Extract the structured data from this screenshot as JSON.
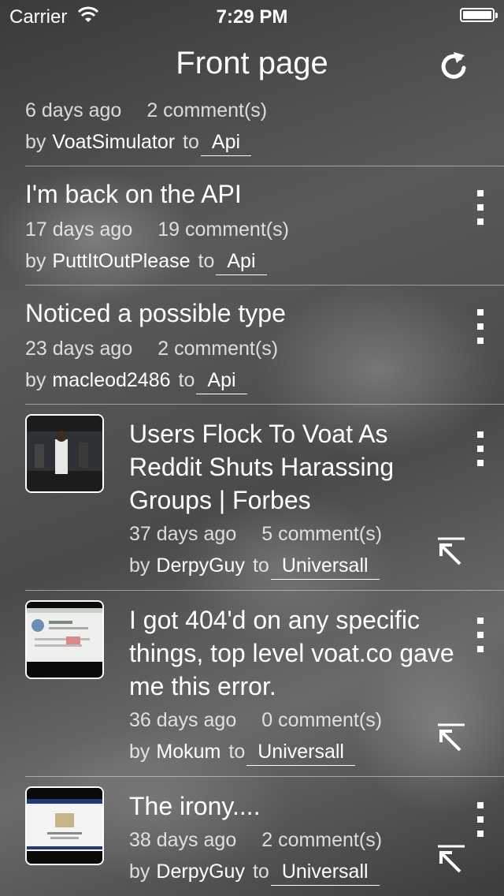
{
  "status_bar": {
    "carrier": "Carrier",
    "time": "7:29 PM"
  },
  "nav": {
    "title": "Front page"
  },
  "posts": [
    {
      "age": "6 days ago",
      "comments": "2 comment(s)",
      "by": "by",
      "user": "VoatSimulator",
      "to": "to",
      "subverse": "Api"
    },
    {
      "title": "I'm back on the API",
      "age": "17 days ago",
      "comments": "19 comment(s)",
      "by": "by",
      "user": "PuttItOutPlease",
      "to": "to",
      "subverse": "Api"
    },
    {
      "title": "Noticed a possible type",
      "age": "23 days ago",
      "comments": "2 comment(s)",
      "by": "by",
      "user": "macleod2486",
      "to": "to",
      "subverse": "Api"
    },
    {
      "title": "Users Flock To Voat As Reddit Shuts Harassing Groups | Forbes",
      "age": "37 days ago",
      "comments": "5 comment(s)",
      "by": "by",
      "user": "DerpyGuy",
      "to": "to",
      "subverse": "Universall"
    },
    {
      "title": "I got 404'd on any specific things, top level voat.co gave me this error.",
      "age": "36 days ago",
      "comments": "0 comment(s)",
      "by": "by",
      "user": "Mokum",
      "to": "to",
      "subverse": "Universall"
    },
    {
      "title": "The irony....",
      "age": "38 days ago",
      "comments": "2 comment(s)",
      "by": "by",
      "user": "DerpyGuy",
      "to": "to",
      "subverse": "Universall"
    }
  ],
  "icons": {
    "refresh": "refresh-icon",
    "more": "more-vertical-icon",
    "open_link": "open-link-arrow-icon",
    "wifi": "wifi-icon",
    "battery": "battery-icon"
  }
}
